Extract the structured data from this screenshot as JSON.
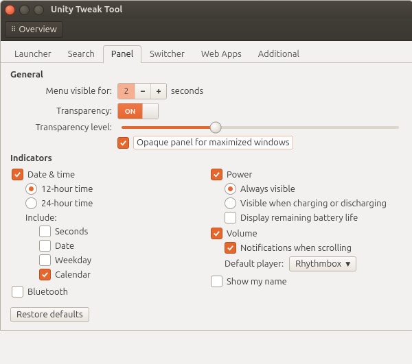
{
  "window": {
    "title": "Unity Tweak Tool"
  },
  "toolbar": {
    "overview_label": "Overview"
  },
  "tabs": [
    "Launcher",
    "Search",
    "Panel",
    "Switcher",
    "Web Apps",
    "Additional"
  ],
  "active_tab": 2,
  "general": {
    "heading": "General",
    "menu_visible_label": "Menu visible for:",
    "menu_visible_value": "2",
    "menu_visible_unit": "seconds",
    "transparency_label": "Transparency:",
    "transparency_switch": "ON",
    "transparency_level_label": "Transparency level:",
    "transparency_level_percent": 34,
    "opaque_checkbox": {
      "checked": true,
      "label": "Opaque panel for maximized windows"
    }
  },
  "indicators": {
    "heading": "Indicators",
    "date_time": {
      "checked": true,
      "label": "Date & time",
      "mode_12": {
        "selected": true,
        "label": "12-hour time"
      },
      "mode_24": {
        "selected": false,
        "label": "24-hour time"
      },
      "include_label": "Include:",
      "include": {
        "seconds": {
          "checked": false,
          "label": "Seconds"
        },
        "date": {
          "checked": false,
          "label": "Date"
        },
        "weekday": {
          "checked": false,
          "label": "Weekday"
        },
        "calendar": {
          "checked": true,
          "label": "Calendar"
        }
      }
    },
    "bluetooth": {
      "checked": false,
      "label": "Bluetooth"
    },
    "power": {
      "checked": true,
      "label": "Power",
      "always": {
        "selected": true,
        "label": "Always visible"
      },
      "charging": {
        "selected": false,
        "label": "Visible when charging or discharging"
      },
      "remaining": {
        "checked": false,
        "label": "Display remaining battery life"
      }
    },
    "volume": {
      "checked": true,
      "label": "Volume",
      "notif": {
        "checked": true,
        "label": "Notifications when scrolling"
      },
      "player_label": "Default player:",
      "player_value": "Rhythmbox"
    },
    "show_name": {
      "checked": false,
      "label": "Show my name"
    }
  },
  "footer": {
    "restore_label": "Restore defaults"
  }
}
